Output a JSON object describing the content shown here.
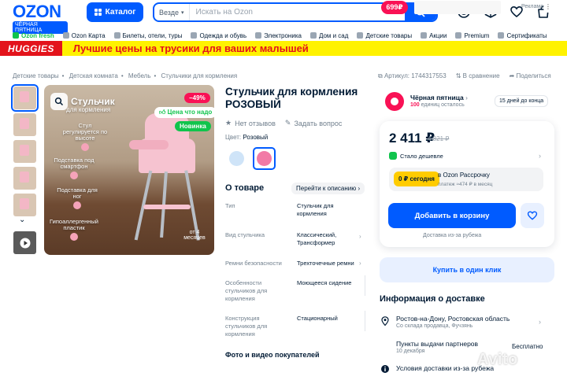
{
  "header": {
    "logo": "OZON",
    "logo_sub": "ЧЁРНАЯ ПЯТНИЦА",
    "catalog": "Каталог",
    "search_scope": "Везде",
    "search_placeholder": "Искать на Ozon"
  },
  "nav": [
    "Ozon fresh",
    "Ozon Карта",
    "Билеты, отели, туры",
    "Одежда и обувь",
    "Электроника",
    "Дом и сад",
    "Детские товары",
    "Акции",
    "Premium",
    "Сертификаты"
  ],
  "banner": {
    "brand": "HUGGIES",
    "text": "Лучшие цены на трусики для ваших малышей",
    "price_badge": "699₽",
    "ad_label": "Реклама"
  },
  "breadcrumbs": [
    "Детские товары",
    "Детская комната",
    "Мебель",
    "Стульчики для кормления"
  ],
  "article": {
    "sku": "Артикул: 1744317553",
    "compare": "В сравнение",
    "share": "Поделиться"
  },
  "gallery": {
    "title_line1": "Стульчик",
    "title_line2": "для кормления",
    "features": [
      "Стул регулируется по высоте",
      "Подставка под смартфон",
      "Подставка для ног",
      "Гипоаллергенный пластик"
    ],
    "sale": "−49%",
    "price_badge": "Цена что надо",
    "new_badge": "Новинка",
    "age_badge": "от 4 месяцев"
  },
  "product": {
    "title": "Стульчик для кормления РОЗОВЫЙ",
    "reviews": "Нет отзывов",
    "ask": "Задать вопрос",
    "color_label": "Цвет:",
    "color_value": "Розовый",
    "swatches": [
      "#cfe4f8",
      "#f27aa6"
    ]
  },
  "about": {
    "title": "О товаре",
    "link": "Перейти к описанию",
    "rows": [
      {
        "k": "Тип",
        "v": "Стульчик для кормления"
      },
      {
        "k": "Вид стульчика",
        "v": "Классический, Трансформер"
      },
      {
        "k": "Ремни безопасности",
        "v": "Трехточечные ремни"
      },
      {
        "k": "Особенности стульчиков для кормления",
        "v": "Моющееся сидение"
      },
      {
        "k": "Конструкция стульчиков для кормления",
        "v": "Стационарный"
      }
    ],
    "photos": "Фото и видео покупателей"
  },
  "seller": {
    "name": "Чёрная пятница",
    "sub_count": "100",
    "sub_text": "единиц осталось",
    "days": "15 дней до конца"
  },
  "buy": {
    "price": "2 411 ₽",
    "old_price": "4 821 ₽",
    "cheaper": "Стало дешевле",
    "rs_badge": "0 ₽ сегодня",
    "rs_title": "в Ozon Рассрочку",
    "rs_sub": "платеж ≈474 ₽ в месяц",
    "cart": "Добавить в корзину",
    "delivery_small": "Доставка из-за рубежа",
    "oneclick": "Купить в один клик"
  },
  "delivery": {
    "title": "Информация о доставке",
    "city": "Ростов-на-Дону, Ростовская область",
    "city_sub": "Со склада продавца, Фучзянь",
    "pickup": "Пункты выдачи партнеров",
    "pickup_date": "10 декабря",
    "pickup_price": "Бесплатно",
    "conditions": "Условия доставки из-за рубежа"
  },
  "watermark": "Avito",
  "colors": {
    "accent": "#005bff",
    "sale": "#f91155",
    "green": "#10c44c"
  }
}
